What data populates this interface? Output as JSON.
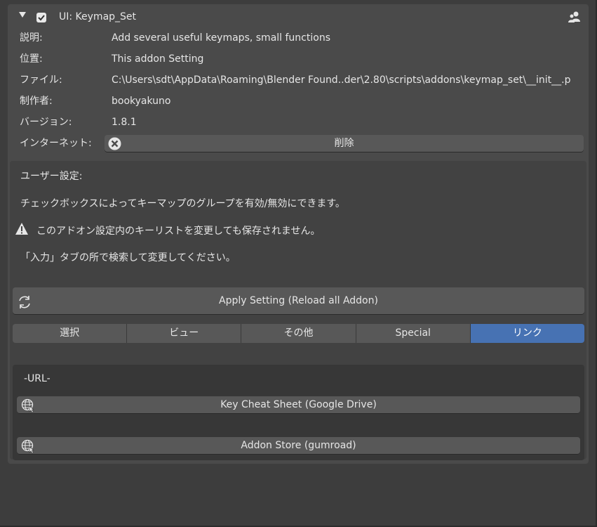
{
  "header": {
    "title": "UI: Keymap_Set"
  },
  "info": [
    {
      "label": "説明:",
      "value": "Add several useful keymaps, small functions"
    },
    {
      "label": "位置:",
      "value": "This addon Setting"
    },
    {
      "label": "ファイル:",
      "value": "C:\\Users\\sdt\\AppData\\Roaming\\Blender Found..der\\2.80\\scripts\\addons\\keymap_set\\__init__.p"
    },
    {
      "label": "制作者:",
      "value": "bookyakuno"
    },
    {
      "label": "バージョン:",
      "value": "1.8.1"
    },
    {
      "label": "インターネット:",
      "value": ""
    }
  ],
  "remove_label": "削除",
  "prefs": {
    "heading": "ユーザー設定:",
    "line1": "チェックボックスによってキーマップのグループを有効/無効にできます。",
    "warning": "このアドオン設定内のキーリストを変更しても保存されません。",
    "line3": "「入力」タブの所で検索して変更してください。"
  },
  "apply_label": "Apply Setting (Reload all Addon)",
  "tabs": [
    {
      "label": "選択",
      "active": false
    },
    {
      "label": "ビュー",
      "active": false
    },
    {
      "label": "その他",
      "active": false
    },
    {
      "label": "Special",
      "active": false
    },
    {
      "label": "リンク",
      "active": true
    }
  ],
  "url": {
    "heading": "-URL-",
    "links": [
      {
        "label": "Key Cheat Sheet (Google Drive)"
      },
      {
        "label": "Addon Store (gumroad)"
      }
    ]
  },
  "colors": {
    "panel": "#4a4a4a",
    "button": "#585858",
    "active_tab": "#4772b3",
    "text": "#e6e6e6"
  }
}
